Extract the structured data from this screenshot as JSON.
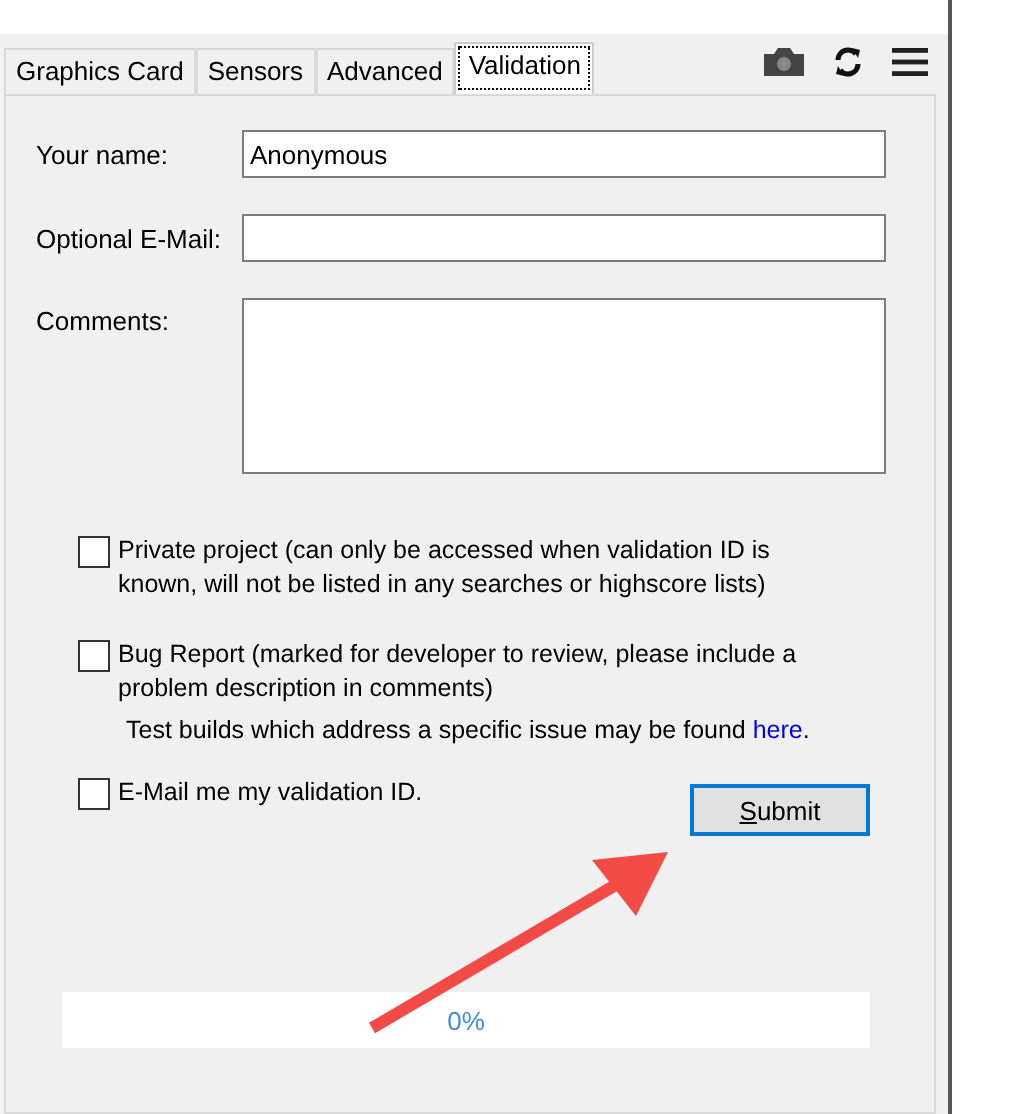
{
  "tabs": [
    {
      "label": "Graphics Card",
      "selected": false
    },
    {
      "label": "Sensors",
      "selected": false
    },
    {
      "label": "Advanced",
      "selected": false
    },
    {
      "label": "Validation",
      "selected": true
    }
  ],
  "form": {
    "fields": [
      {
        "label": "Your name:",
        "value": "Anonymous",
        "kind": "line"
      },
      {
        "label": "Optional E-Mail:",
        "kind": "line"
      },
      {
        "label": "Comments:",
        "kind": "area"
      }
    ]
  },
  "options": [
    {
      "label": "Private project (can only be accessed when validation ID is known, will not be listed in any searches or highscore lists)",
      "checked": false
    },
    {
      "label": "Bug Report (marked for developer to review, please include a problem description in comments)",
      "checked": false,
      "note": "Test builds which address a specific issue may be found",
      "link": "here",
      "note_end": "."
    }
  ],
  "email_option": {
    "label": "E-Mail me my validation ID.",
    "checked": false
  },
  "submit": {
    "label": "Submit"
  },
  "progress": {
    "level": 0,
    "reading": "0%"
  }
}
